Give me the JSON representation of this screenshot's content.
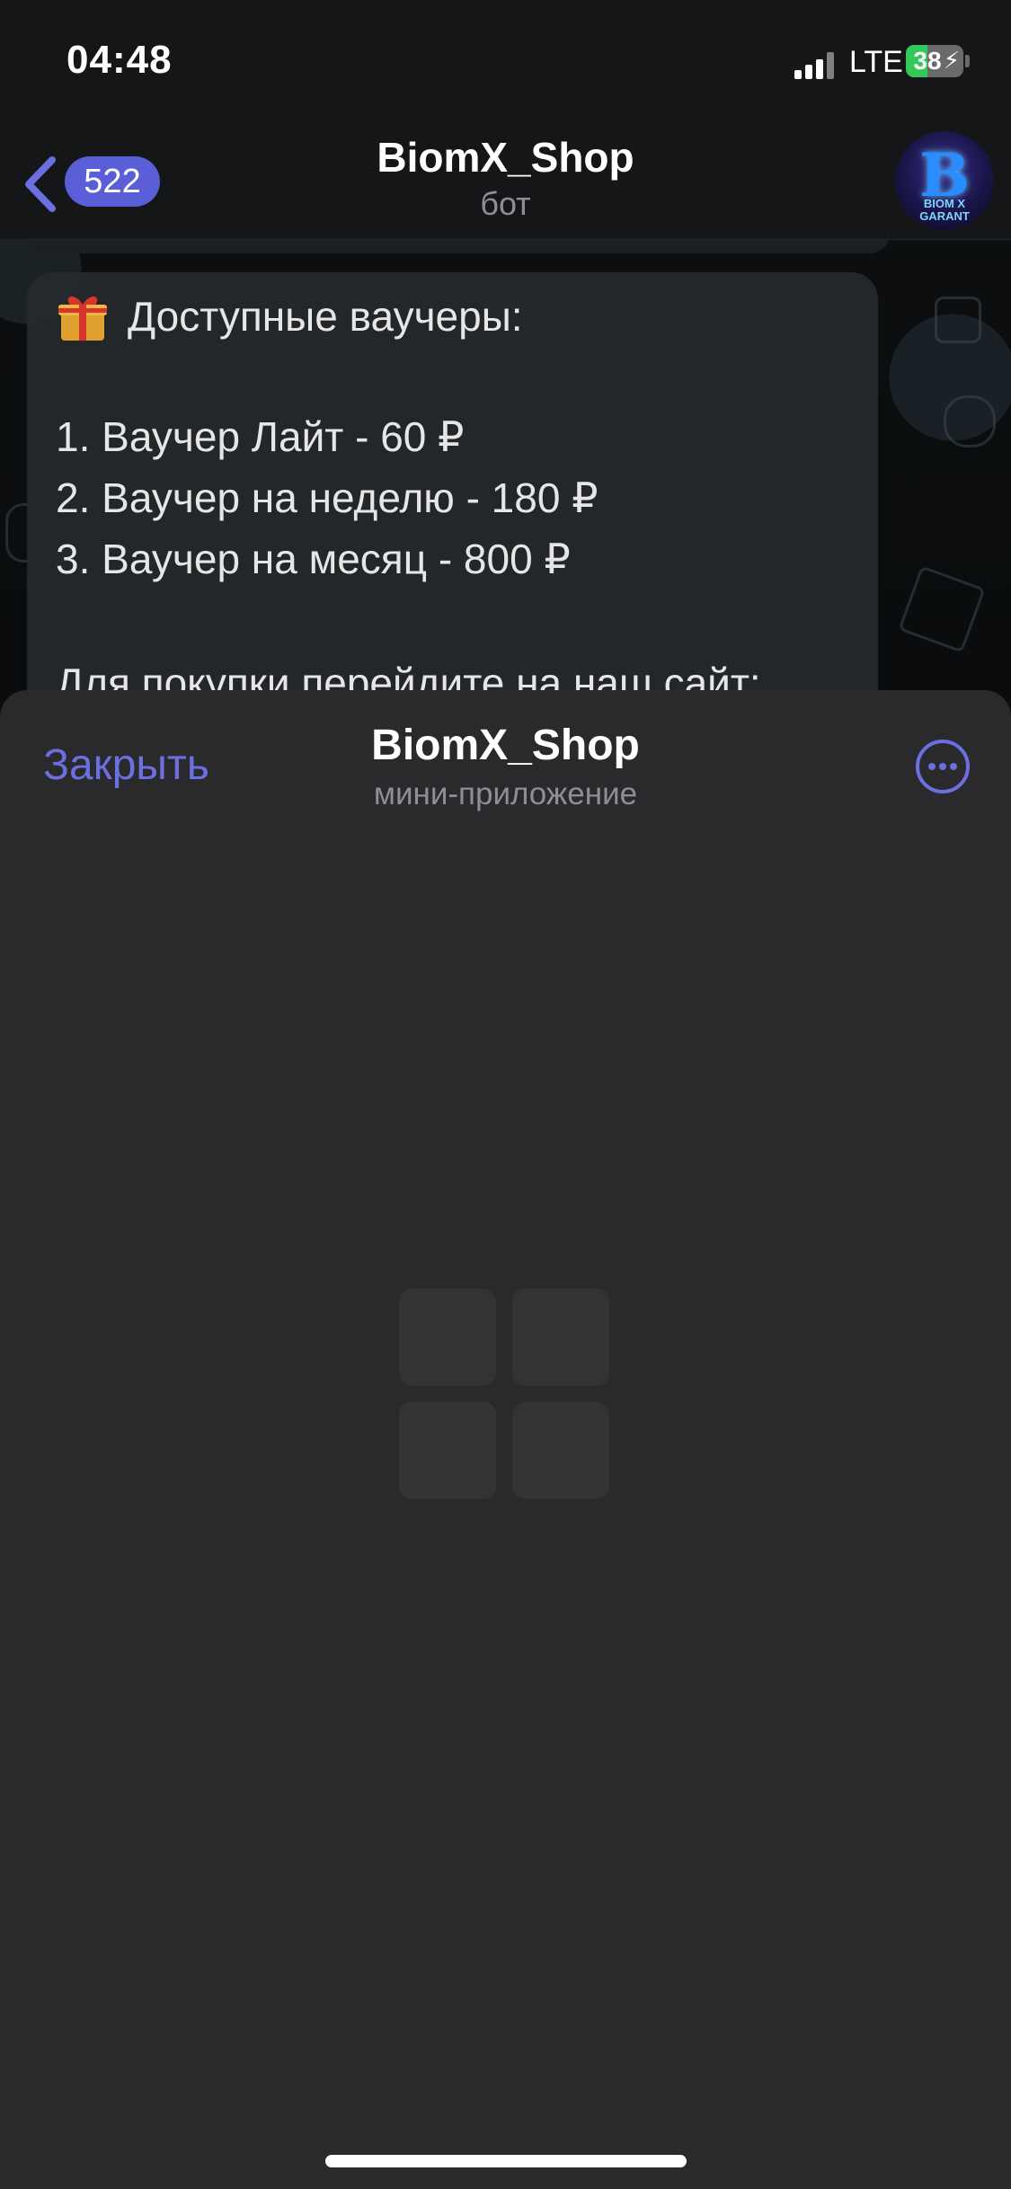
{
  "status_bar": {
    "time": "04:48",
    "network": "LTE",
    "battery_percent": 38,
    "battery_label": "38",
    "charging": true
  },
  "chat_header": {
    "unread_count": "522",
    "title": "BiomX_Shop",
    "subtitle": "бот",
    "avatar_letter": "B",
    "avatar_caption_line1": "BIOM X",
    "avatar_caption_line2": "GARANT"
  },
  "message": {
    "heading": "Доступные ваучеры:",
    "items": [
      "1. Ваучер Лайт - 60 ₽",
      "2. Ваучер на неделю - 180 ₽",
      "3. Ваучер на месяц - 800 ₽"
    ],
    "footer_partial": "Для покупки перейдите на наш сайт:"
  },
  "mini_app": {
    "close_label": "Закрыть",
    "title": "BiomX_Shop",
    "subtitle": "мини-приложение"
  },
  "icons": {
    "back": "chevron-left-icon",
    "more": "more-horizontal-icon",
    "gift": "gift-icon",
    "loader": "grid-loader-icon"
  },
  "colors": {
    "accent": "#6b6fe0",
    "badge": "#5a5fd8",
    "sheet_bg": "#2a2a2c",
    "battery_green": "#34c759"
  }
}
